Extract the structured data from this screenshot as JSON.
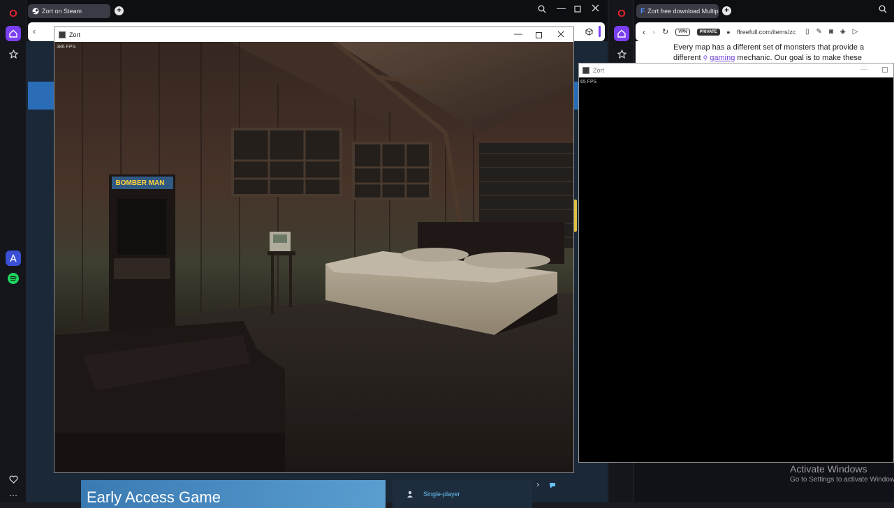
{
  "left_browser": {
    "tab_title": "Zort on Steam",
    "game_window": {
      "title": "Zort",
      "fps": "386 FPS",
      "arcade_marquee": "BOMBER MAN"
    },
    "steam_page": {
      "banner": "Early Access Game",
      "feature": "Single-player"
    }
  },
  "right_browser": {
    "tab_title": "Zort free download Multip",
    "vpn_badge": "VPN",
    "private_badge": "PRIVATE",
    "url": "ffreefull.com/items/zc",
    "page_text_line1": "Every map has a different set of monsters that provide a",
    "page_text_line2_pre": "different",
    "page_text_link": "gaming",
    "page_text_line2_post": "mechanic. Our goal is to make these",
    "game_window": {
      "title": "Zort",
      "fps": "65 FPS"
    }
  },
  "watermark": {
    "line1": "Activate Windows",
    "line2": "Go to Settings to activate Windows."
  },
  "colors": {
    "opera_red": "#e0242f",
    "opera_accent": "#7b3ff2",
    "steam_blue": "#2a6db6"
  }
}
